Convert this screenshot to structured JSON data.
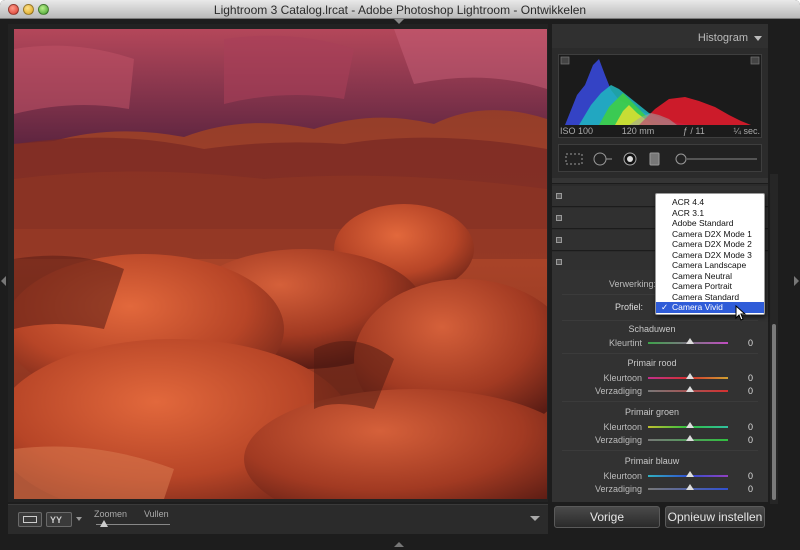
{
  "window": {
    "title": "Lightroom 3 Catalog.lrcat - Adobe Photoshop Lightroom - Ontwikkelen"
  },
  "toolbar": {
    "zoom_label": "Zoomen",
    "fill_label": "Vullen"
  },
  "histogram": {
    "title": "Histogram",
    "iso": "ISO 100",
    "focal": "120 mm",
    "aperture": "ƒ / 11",
    "shutter": "¼ sec."
  },
  "camera_calibration": {
    "processing_label": "Verwerking:",
    "profile_label": "Profiel:",
    "shadows": {
      "header": "Schaduwen",
      "tint_label": "Kleurtint",
      "tint_value": "0"
    },
    "red": {
      "header": "Primair rood",
      "hue_label": "Kleurtoon",
      "hue_value": "0",
      "sat_label": "Verzadiging",
      "sat_value": "0"
    },
    "green": {
      "header": "Primair groen",
      "hue_label": "Kleurtoon",
      "hue_value": "0",
      "sat_label": "Verzadiging",
      "sat_value": "0"
    },
    "blue": {
      "header": "Primair blauw",
      "hue_label": "Kleurtoon",
      "hue_value": "0",
      "sat_label": "Verzadiging",
      "sat_value": "0"
    }
  },
  "profile_menu": {
    "items": [
      "ACR 4.4",
      "ACR 3.1",
      "Adobe Standard",
      "Camera D2X Mode 1",
      "Camera D2X Mode 2",
      "Camera D2X Mode 3",
      "Camera Landscape",
      "Camera Neutral",
      "Camera Portrait",
      "Camera Standard",
      "Camera Vivid"
    ],
    "selected": "Camera Vivid",
    "check_mark": "✓"
  },
  "buttons": {
    "previous": "Vorige",
    "reset": "Opnieuw instellen"
  },
  "colors": {
    "panel_bg": "#2b2b2b",
    "menu_highlight": "#2f5cd8"
  }
}
